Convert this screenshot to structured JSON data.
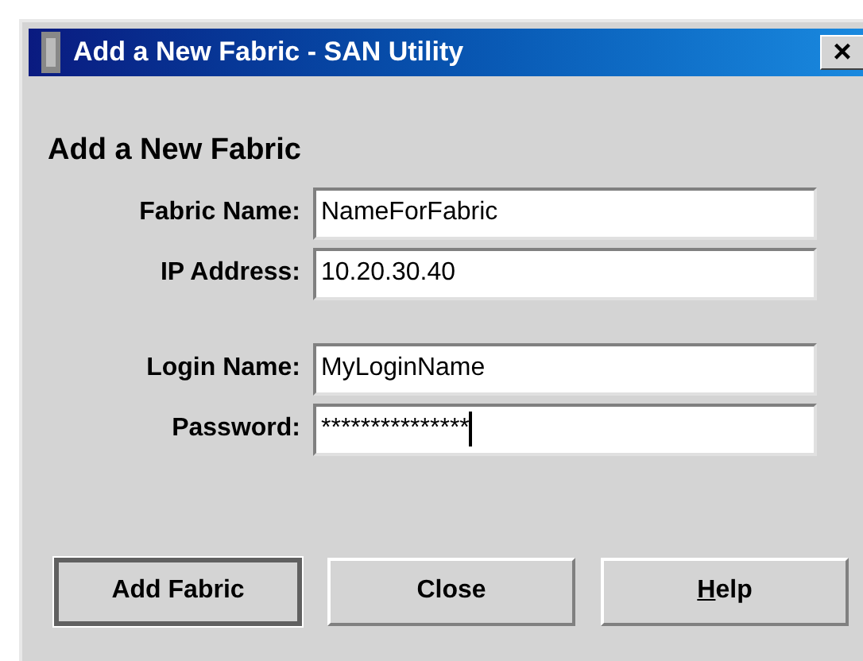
{
  "window": {
    "title": "Add a New Fabric - SAN Utility",
    "close": "×"
  },
  "heading": "Add a New Fabric",
  "groups": [
    [
      {
        "label": "Fabric Name:",
        "value": "NameForFabric",
        "focused": false
      },
      {
        "label": "IP Address:",
        "value": "10.20.30.40",
        "focused": false
      }
    ],
    [
      {
        "label": "Login Name:",
        "value": "MyLoginName",
        "focused": false
      },
      {
        "label": "Password:",
        "value": "***************",
        "focused": true
      }
    ]
  ],
  "buttons": [
    {
      "label": "Add Fabric",
      "default": true
    },
    {
      "label": "Close",
      "default": false
    },
    {
      "label": "elp",
      "mnemonic": "H",
      "default": false
    }
  ]
}
